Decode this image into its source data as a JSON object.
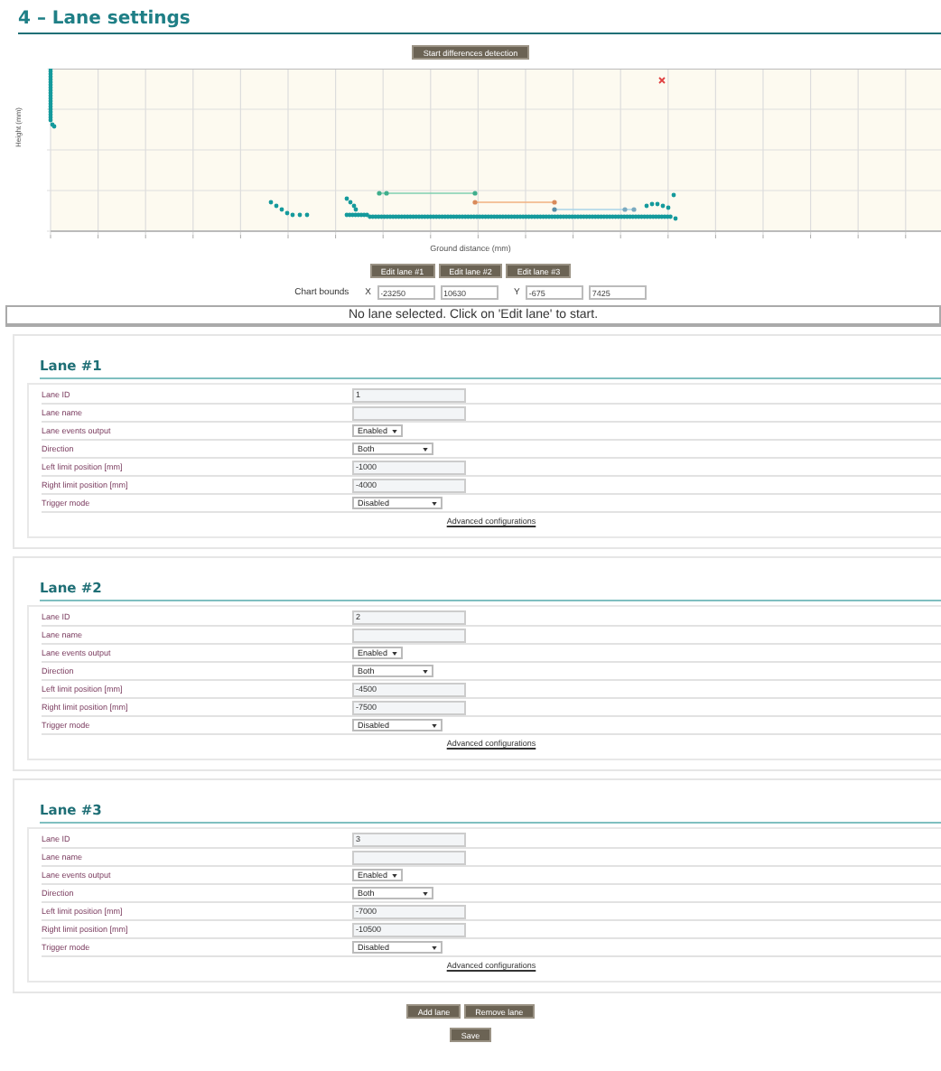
{
  "page_title": "4 – Lane settings",
  "detect_button": "Start differences detection",
  "chart": {
    "ylabel": "Height (mm)",
    "xlabel": "Ground distance (mm)"
  },
  "edit_buttons": [
    "Edit lane #1",
    "Edit lane #2",
    "Edit lane #3"
  ],
  "bounds": {
    "label": "Chart bounds",
    "x_label": "X",
    "x_min": "-23250",
    "x_max": "10630",
    "y_label": "Y",
    "y_min": "-675",
    "y_max": "7425"
  },
  "status": "No lane selected. Click on 'Edit lane' to start.",
  "lanes": [
    {
      "title": "Lane #1",
      "link": "Advanced configurations",
      "fields": [
        {
          "label": "Lane ID",
          "kind": "text",
          "value": "1"
        },
        {
          "label": "Lane name",
          "kind": "text"
        },
        {
          "label": "Lane events output",
          "kind": "select",
          "value": "Enabled"
        },
        {
          "label": "Direction",
          "kind": "select",
          "value": "Both"
        },
        {
          "label": "Left limit position [mm]",
          "kind": "text",
          "value": "-1000"
        },
        {
          "label": "Right limit position [mm]",
          "kind": "text",
          "value": "-4000"
        },
        {
          "label": "Trigger mode",
          "kind": "select",
          "value": "Disabled"
        }
      ]
    },
    {
      "title": "Lane #2",
      "link": "Advanced configurations",
      "fields": [
        {
          "label": "Lane ID",
          "kind": "text",
          "value": "2"
        },
        {
          "label": "Lane name",
          "kind": "text"
        },
        {
          "label": "Lane events output",
          "kind": "select",
          "value": "Enabled"
        },
        {
          "label": "Direction",
          "kind": "select",
          "value": "Both"
        },
        {
          "label": "Left limit position [mm]",
          "kind": "text",
          "value": "-4500"
        },
        {
          "label": "Right limit position [mm]",
          "kind": "text",
          "value": "-7500"
        },
        {
          "label": "Trigger mode",
          "kind": "select",
          "value": "Disabled"
        }
      ]
    },
    {
      "title": "Lane #3",
      "link": "Advanced configurations",
      "fields": [
        {
          "label": "Lane ID",
          "kind": "text",
          "value": "3"
        },
        {
          "label": "Lane name",
          "kind": "text"
        },
        {
          "label": "Lane events output",
          "kind": "select",
          "value": "Enabled"
        },
        {
          "label": "Direction",
          "kind": "select",
          "value": "Both"
        },
        {
          "label": "Left limit position [mm]",
          "kind": "text",
          "value": "-7000"
        },
        {
          "label": "Right limit position [mm]",
          "kind": "text",
          "value": "-10500"
        },
        {
          "label": "Trigger mode",
          "kind": "select",
          "value": "Disabled"
        }
      ]
    }
  ],
  "actions": [
    "Add lane",
    "Remove lane"
  ],
  "save": "Save"
}
